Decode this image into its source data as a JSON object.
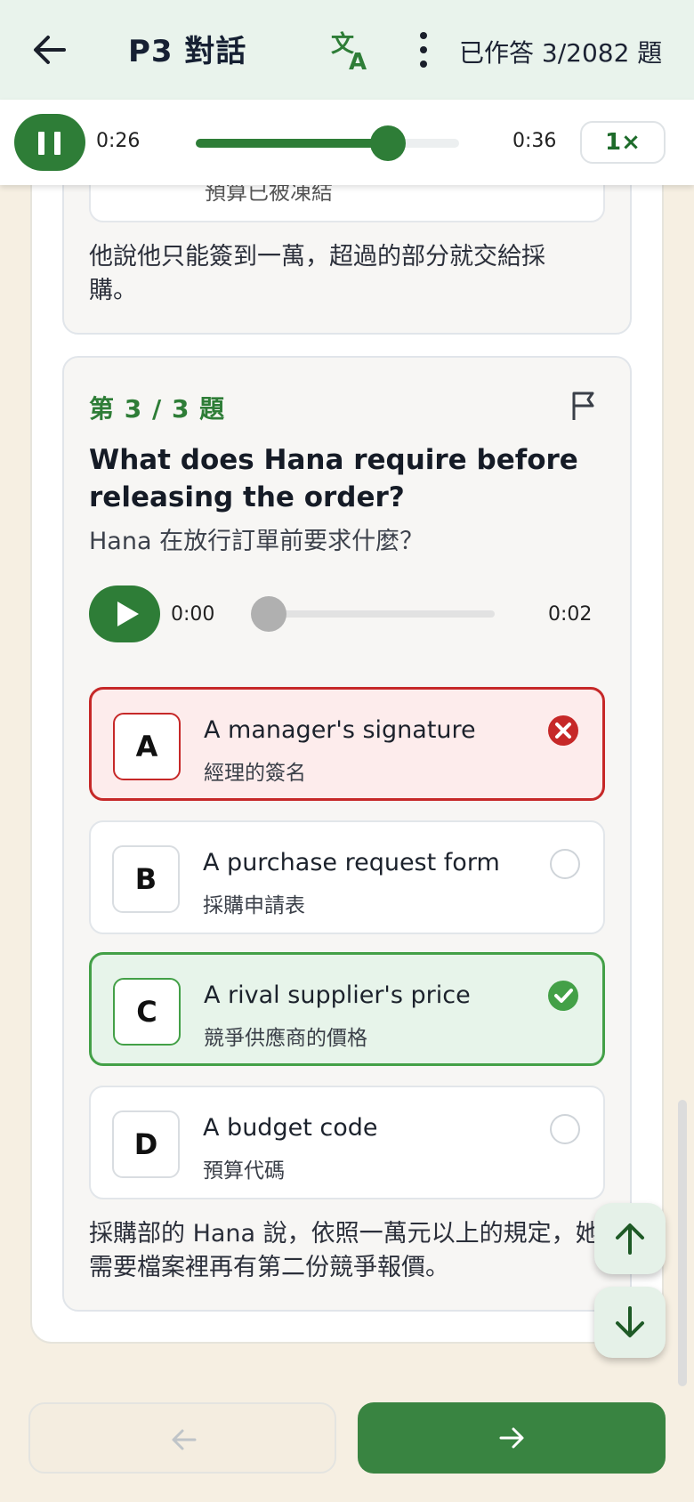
{
  "header": {
    "title": "P3 對話",
    "answered_count": "已作答 3/2082 題",
    "back_icon": "arrow-left-icon",
    "translate_icon": "translate-icon",
    "more_icon": "more-vertical-icon"
  },
  "audio_player": {
    "current_time": "0:26",
    "duration": "0:36",
    "progress": 0.73,
    "speed_label": "1×",
    "state": "playing"
  },
  "previous_question": {
    "option_partial_text": "預算已被凍結",
    "explanation": "他說他只能簽到一萬，超過的部分就交給採購。"
  },
  "question": {
    "number_label": "第 3 / 3 題",
    "title_en": "What does Hana require before releasing the order?",
    "title_zh": "Hana 在放行訂單前要求什麼？",
    "audio": {
      "current_time": "0:00",
      "duration": "0:02",
      "progress": 0.0
    },
    "options": [
      {
        "letter": "A",
        "en": "A manager's signature",
        "zh": "經理的簽名",
        "state": "wrong"
      },
      {
        "letter": "B",
        "en": "A purchase request form",
        "zh": "採購申請表",
        "state": "unselected"
      },
      {
        "letter": "C",
        "en": "A rival supplier's price",
        "zh": "競爭供應商的價格",
        "state": "correct"
      },
      {
        "letter": "D",
        "en": "A budget code",
        "zh": "預算代碼",
        "state": "unselected"
      }
    ],
    "explanation": "採購部的 Hana 說，依照一萬元以上的規定，她需要檔案裡再有第二份競爭報價。"
  },
  "colors": {
    "primary_green": "#2e7d37",
    "wrong_red": "#c62828",
    "correct_green": "#43a047",
    "background": "#f6efe2"
  }
}
